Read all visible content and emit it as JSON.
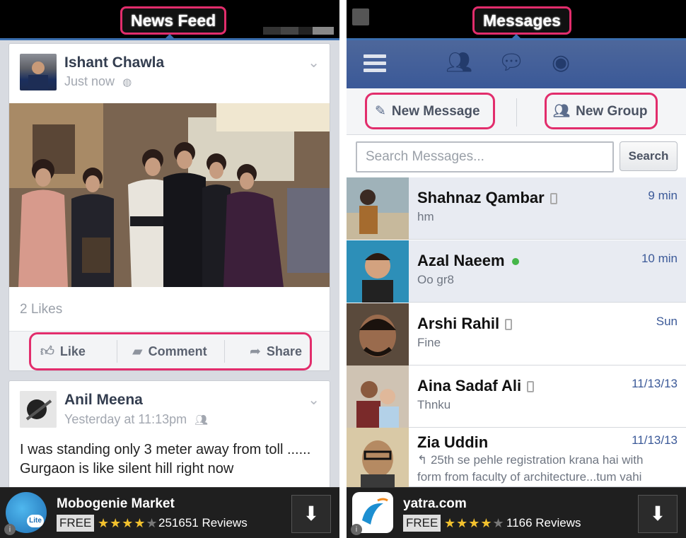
{
  "left": {
    "title": "News Feed",
    "post1": {
      "author": "Ishant Chawla",
      "time": "Just now",
      "likes": "2 Likes",
      "actions": {
        "like": "Like",
        "comment": "Comment",
        "share": "Share"
      }
    },
    "post2": {
      "author": "Anil Meena",
      "time": "Yesterday at 11:13pm",
      "text": "I was standing only 3 meter away from toll ...... Gurgaon is like silent hill right now"
    },
    "ad": {
      "app": "Mobogenie Market",
      "free": "FREE",
      "stars": "★★★★",
      "stars_off": "★",
      "reviews": "251651 Reviews",
      "logo_text": "Lite"
    }
  },
  "right": {
    "title": "Messages",
    "new_message": "New Message",
    "new_group": "New Group",
    "search": {
      "placeholder": "Search Messages...",
      "button": "Search"
    },
    "threads": [
      {
        "name": "Shahnaz Qambar",
        "time": "9 min",
        "message": "hm",
        "status": "mobile"
      },
      {
        "name": "Azal Naeem",
        "time": "10 min",
        "message": "Oo gr8",
        "status": "online"
      },
      {
        "name": "Arshi Rahil",
        "time": "Sun",
        "message": "Fine",
        "status": "mobile"
      },
      {
        "name": "Aina Sadaf Ali",
        "time": "11/13/13",
        "message": "Thnku",
        "status": "mobile"
      },
      {
        "name": "Zia Uddin",
        "time": "11/13/13",
        "message": "↰ 25th se pehle registration krana hai with form from faculty of architecture...tum vahi"
      }
    ],
    "ad": {
      "app": "yatra.com",
      "free": "FREE",
      "stars": "★★★★",
      "stars_off": "★",
      "reviews": "1166 Reviews"
    }
  },
  "colors": {
    "accent": "#e22d6c",
    "facebook_blue": "#3b5998",
    "online": "#45b649"
  }
}
